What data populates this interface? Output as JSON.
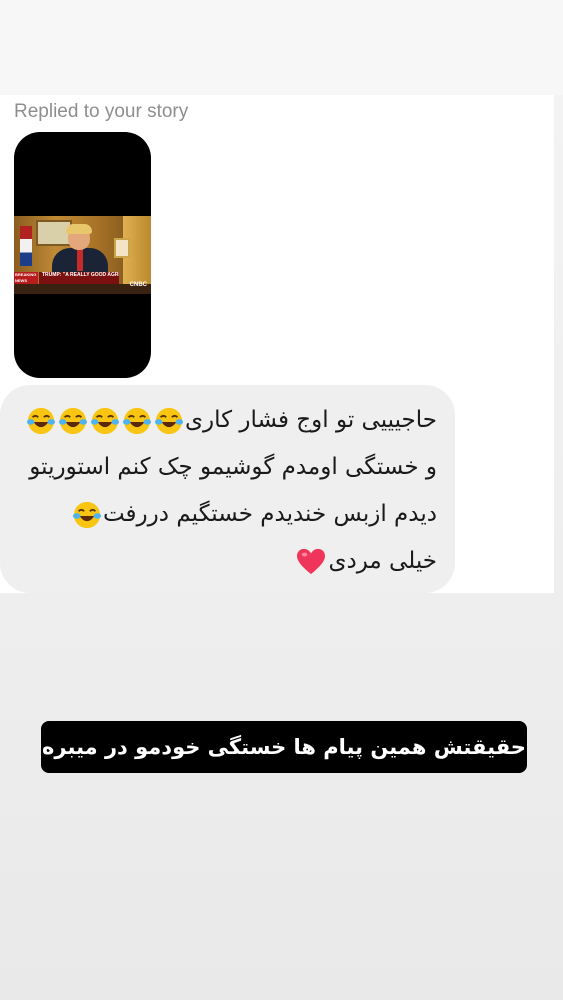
{
  "story_reply": {
    "label": "Replied to your story",
    "video": {
      "breaking_text": "BREAKING NEWS",
      "lower_third": "TRUMP: \"A REALLY GOOD AGREEMENT\" FOR BOTH COUNTRIES",
      "network_logo": "CNBC"
    }
  },
  "message": {
    "lines": [
      "حاجیییی تو اوج فشار کاری",
      "و خستگی اومدم گوشیمو چک کنم استوریتو",
      "دیدم ازبس خندیدم خستگیم دررفت",
      "خیلی مردی"
    ],
    "emojis": {
      "line1": "face-with-tears-of-joy x5",
      "line3": "face-with-tears-of-joy",
      "line4": "red-heart"
    }
  },
  "caption": {
    "text": "حقیقتش همین پیام ها خستگی خودمو در میبره"
  },
  "colors": {
    "bubble": "#efefef",
    "caption_bg": "#000000",
    "caption_text": "#ffffff",
    "label_gray": "#8e8e8e",
    "heart": "#f0355b"
  }
}
